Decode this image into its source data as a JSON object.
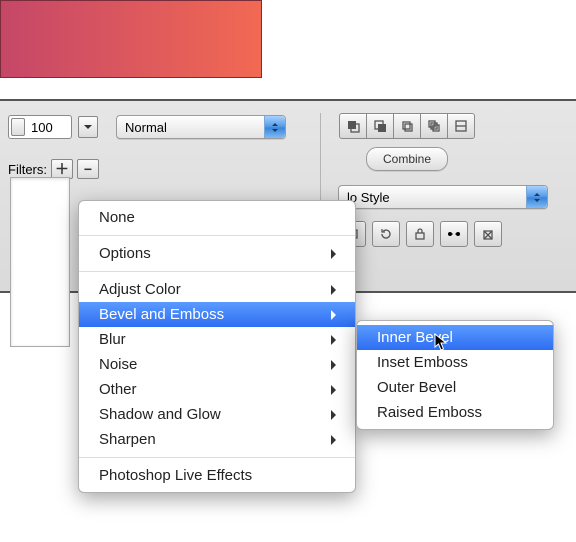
{
  "opacity_value": "100",
  "blend_mode": "Normal",
  "combine_label": "Combine",
  "filters_label": "Filters:",
  "style_select": "lo Style",
  "menu": {
    "none": "None",
    "options": "Options",
    "adjust_color": "Adjust Color",
    "bevel_emboss": "Bevel and Emboss",
    "blur": "Blur",
    "noise": "Noise",
    "other": "Other",
    "shadow_glow": "Shadow and Glow",
    "sharpen": "Sharpen",
    "ps_live": "Photoshop Live Effects"
  },
  "submenu": {
    "inner_bevel": "Inner Bevel",
    "inset_emboss": "Inset Emboss",
    "outer_bevel": "Outer Bevel",
    "raised_emboss": "Raised Emboss"
  }
}
